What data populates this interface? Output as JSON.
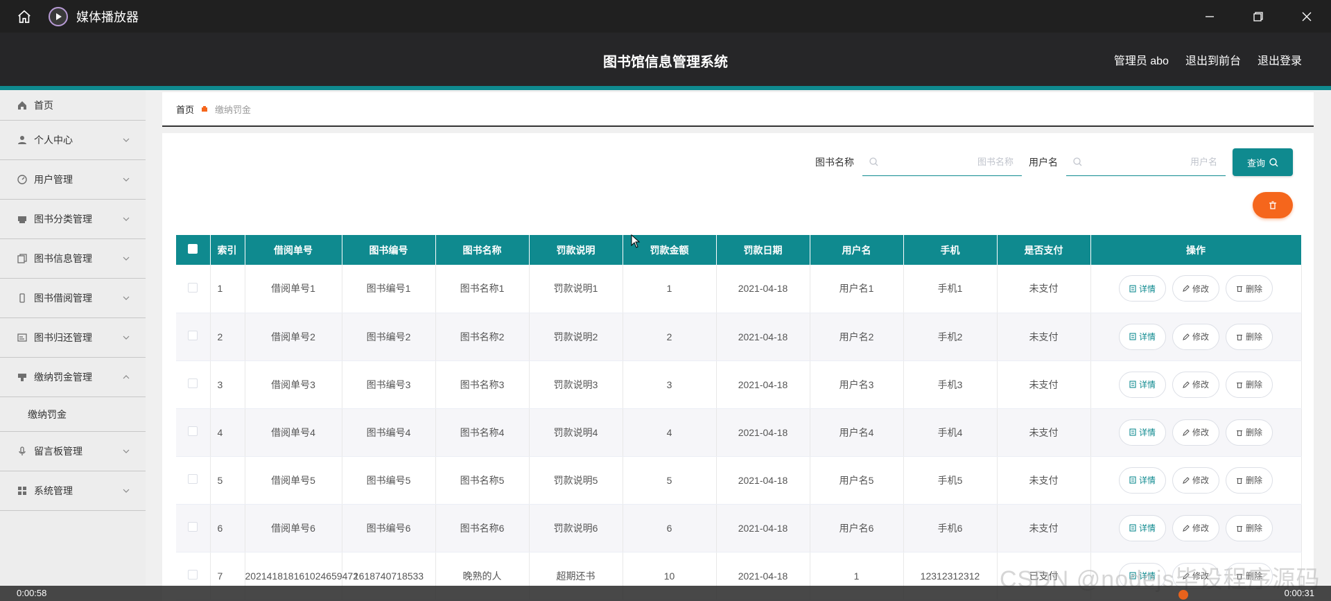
{
  "window": {
    "title": "媒体播放器",
    "icons": [
      "home-icon",
      "media-player-logo-icon",
      "minimize-icon",
      "restore-icon",
      "close-icon"
    ]
  },
  "header": {
    "title": "图书馆信息管理系统",
    "admin": "管理员 abo",
    "back_front": "退出到前台",
    "logout": "退出登录"
  },
  "sidebar": {
    "items": [
      {
        "label": "首页",
        "icon": "home-icon"
      },
      {
        "label": "个人中心",
        "icon": "user-icon"
      },
      {
        "label": "用户管理",
        "icon": "gauge-icon"
      },
      {
        "label": "图书分类管理",
        "icon": "printer-icon"
      },
      {
        "label": "图书信息管理",
        "icon": "copy-icon"
      },
      {
        "label": "图书借阅管理",
        "icon": "phone-icon"
      },
      {
        "label": "图书归还管理",
        "icon": "card-icon"
      },
      {
        "label": "缴纳罚金管理",
        "icon": "stamp-icon"
      },
      {
        "label": "留言板管理",
        "icon": "mic-icon"
      },
      {
        "label": "系统管理",
        "icon": "grid-icon"
      }
    ],
    "submenu": "缴纳罚金"
  },
  "breadcrumb": {
    "home": "首页",
    "current": "缴纳罚金"
  },
  "search": {
    "book_label": "图书名称",
    "book_placeholder": "图书名称",
    "user_label": "用户名",
    "user_placeholder": "用户名",
    "query_label": "查询"
  },
  "table": {
    "headers": [
      "索引",
      "借阅单号",
      "图书编号",
      "图书名称",
      "罚款说明",
      "罚款金额",
      "罚款日期",
      "用户名",
      "手机",
      "是否支付",
      "操作"
    ],
    "actions": {
      "detail": "详情",
      "edit": "修改",
      "delete": "删除"
    },
    "rows": [
      [
        "1",
        "借阅单号1",
        "图书编号1",
        "图书名称1",
        "罚款说明1",
        "1",
        "2021-04-18",
        "用户名1",
        "手机1",
        "未支付"
      ],
      [
        "2",
        "借阅单号2",
        "图书编号2",
        "图书名称2",
        "罚款说明2",
        "2",
        "2021-04-18",
        "用户名2",
        "手机2",
        "未支付"
      ],
      [
        "3",
        "借阅单号3",
        "图书编号3",
        "图书名称3",
        "罚款说明3",
        "3",
        "2021-04-18",
        "用户名3",
        "手机3",
        "未支付"
      ],
      [
        "4",
        "借阅单号4",
        "图书编号4",
        "图书名称4",
        "罚款说明4",
        "4",
        "2021-04-18",
        "用户名4",
        "手机4",
        "未支付"
      ],
      [
        "5",
        "借阅单号5",
        "图书编号5",
        "图书名称5",
        "罚款说明5",
        "5",
        "2021-04-18",
        "用户名5",
        "手机5",
        "未支付"
      ],
      [
        "6",
        "借阅单号6",
        "图书编号6",
        "图书名称6",
        "罚款说明6",
        "6",
        "2021-04-18",
        "用户名6",
        "手机6",
        "未支付"
      ],
      [
        "7",
        "202141818161024659472",
        "1618740718533",
        "晚熟的人",
        "超期还书",
        "10",
        "2021-04-18",
        "1",
        "12312312312",
        "已支付"
      ]
    ]
  },
  "player": {
    "elapsed": "0:00:58",
    "remaining": "0:00:31"
  },
  "watermark": "CSDN @nodejs毕设程序源码",
  "colors": {
    "accent": "#0f8a8f",
    "danger": "#f5661c",
    "header": "#262628"
  }
}
